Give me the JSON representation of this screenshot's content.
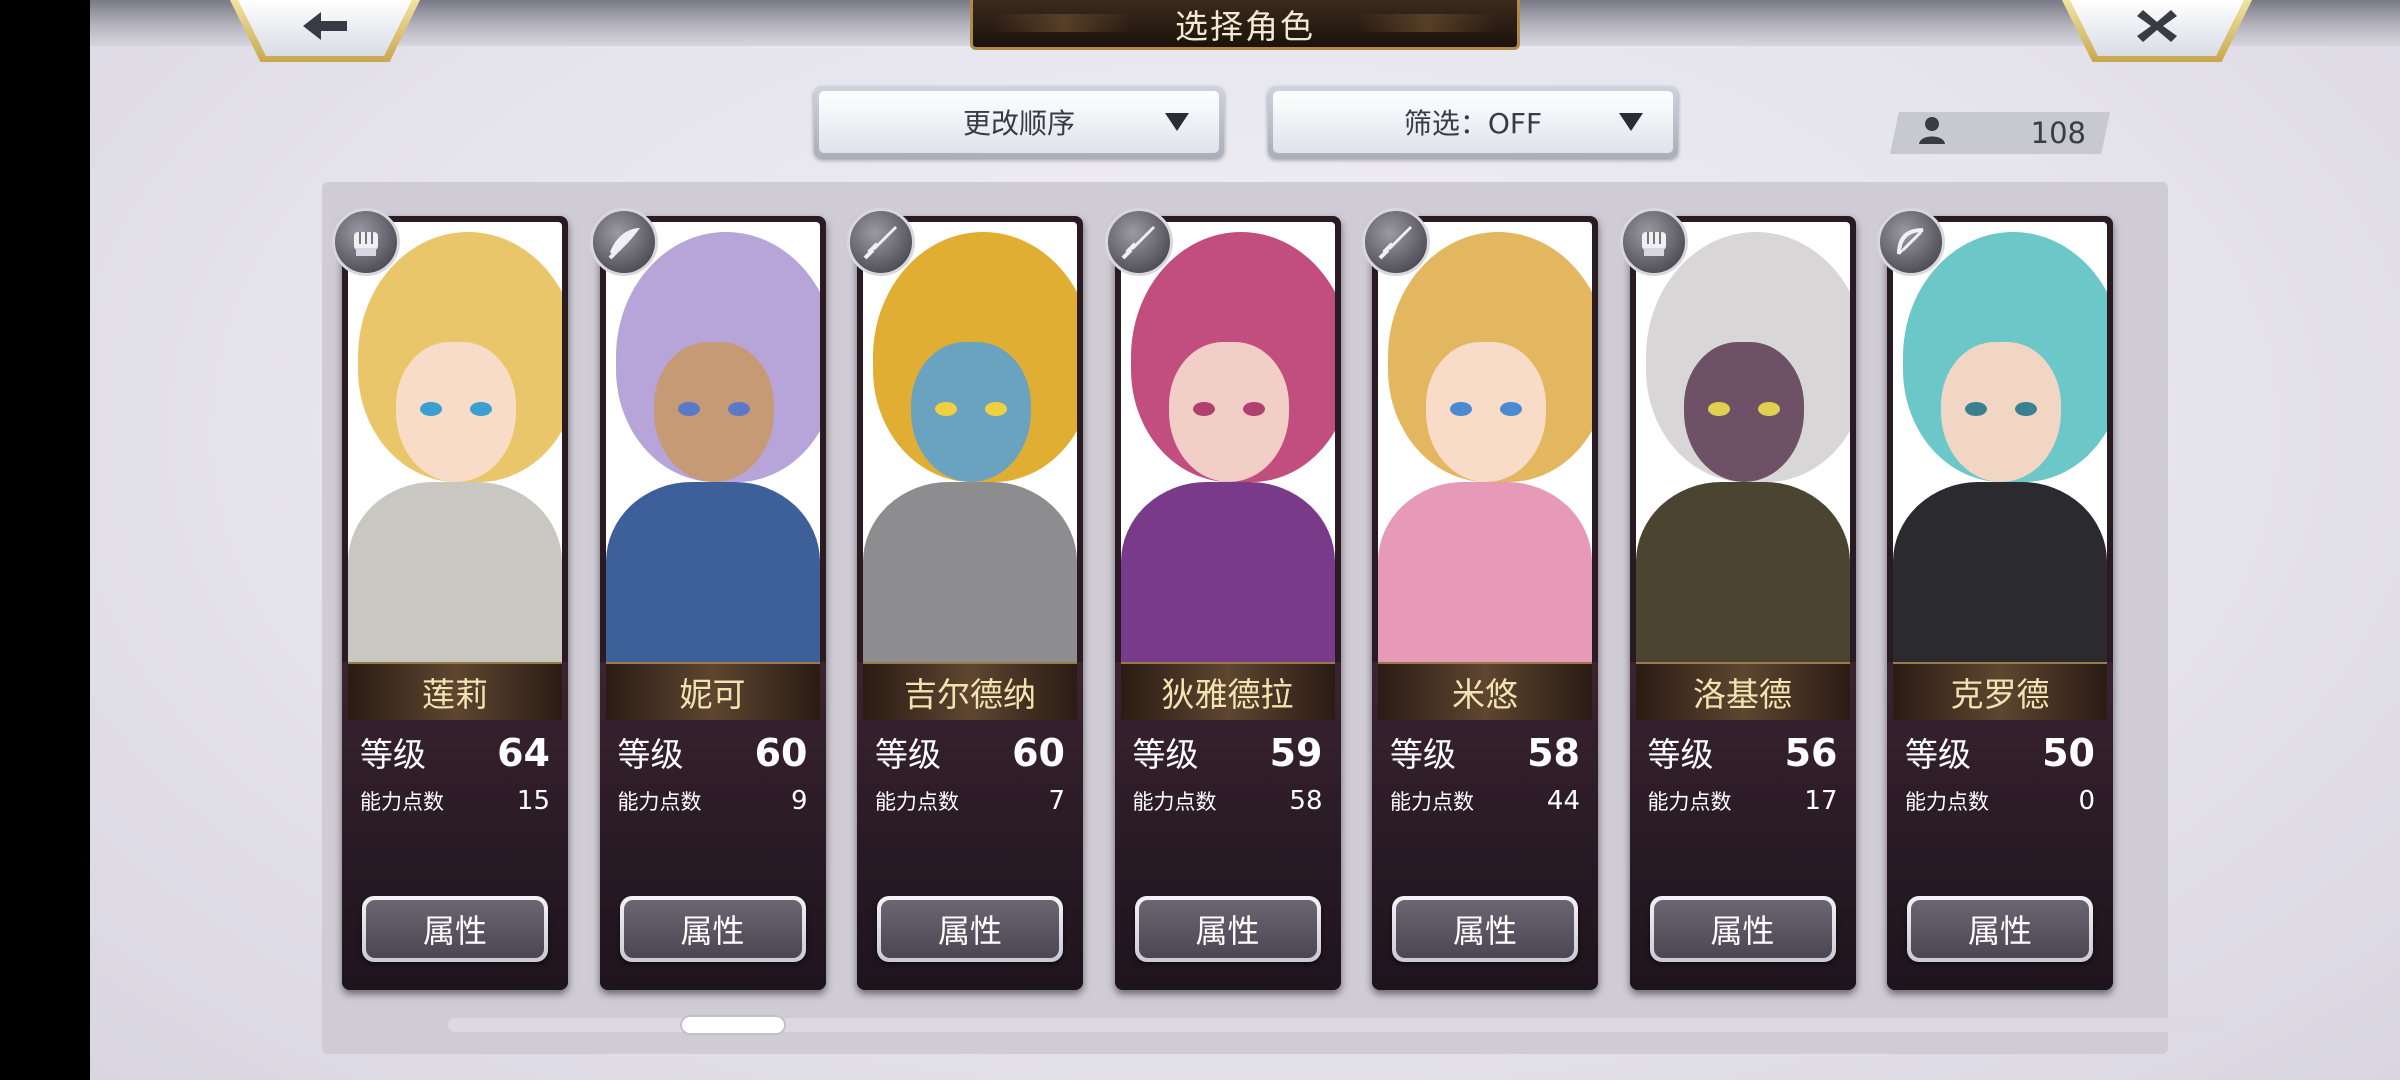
{
  "header": {
    "title": "选择角色",
    "back_icon": "arrow-left-icon",
    "close_icon": "close-x-icon"
  },
  "controls": {
    "sort_label": "更改顺序",
    "filter_label": "筛选：OFF",
    "character_count": "108",
    "count_icon": "person-icon"
  },
  "cards": [
    {
      "name": "莲莉",
      "level_label": "等级",
      "level": "64",
      "points_label": "能力点数",
      "points": "15",
      "button": "属性",
      "class_icon": "fist-icon",
      "hair": "#e9c66a",
      "skin": "#f8dcc8",
      "outfit": "#c9c7c2",
      "eye": "#3aa0d0"
    },
    {
      "name": "妮可",
      "level_label": "等级",
      "level": "60",
      "points_label": "能力点数",
      "points": "9",
      "button": "属性",
      "class_icon": "blade-icon",
      "hair": "#b7a4d9",
      "skin": "#c79a76",
      "outfit": "#3d5f9a",
      "eye": "#5b79c8"
    },
    {
      "name": "吉尔德纳",
      "level_label": "等级",
      "level": "60",
      "points_label": "能力点数",
      "points": "7",
      "button": "属性",
      "class_icon": "sword-icon",
      "hair": "#e0ae33",
      "skin": "#6aa3c0",
      "outfit": "#8d8d8f",
      "eye": "#f0d040"
    },
    {
      "name": "狄雅德拉",
      "level_label": "等级",
      "level": "59",
      "points_label": "能力点数",
      "points": "58",
      "button": "属性",
      "class_icon": "sword-icon",
      "hair": "#c24d7f",
      "skin": "#f1cfc6",
      "outfit": "#7a3a8a",
      "eye": "#b04070"
    },
    {
      "name": "米悠",
      "level_label": "等级",
      "level": "58",
      "points_label": "能力点数",
      "points": "44",
      "button": "属性",
      "class_icon": "sword-icon",
      "hair": "#e3b760",
      "skin": "#f8dcc8",
      "outfit": "#e79ab8",
      "eye": "#4a8ad0"
    },
    {
      "name": "洛基德",
      "level_label": "等级",
      "level": "56",
      "points_label": "能力点数",
      "points": "17",
      "button": "属性",
      "class_icon": "fist-icon",
      "hair": "#d8d6d6",
      "skin": "#6e5166",
      "outfit": "#4a4430",
      "eye": "#e0d050"
    },
    {
      "name": "克罗德",
      "level_label": "等级",
      "level": "50",
      "points_label": "能力点数",
      "points": "0",
      "button": "属性",
      "class_icon": "bow-icon",
      "hair": "#6cc7c9",
      "skin": "#f1d6c4",
      "outfit": "#2b2a2e",
      "eye": "#3a8090"
    }
  ],
  "scroll": {
    "position": 0.12
  }
}
